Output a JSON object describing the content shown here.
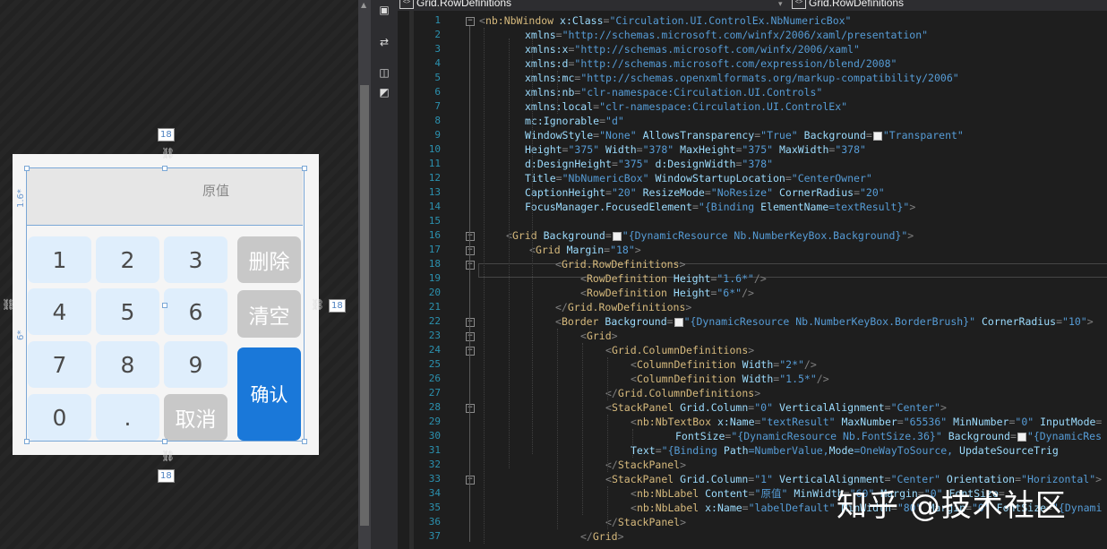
{
  "tabs": [
    {
      "label": "Grid.RowDefinitions"
    },
    {
      "label": "Grid.RowDefinitions"
    }
  ],
  "designer": {
    "result_label": "原值",
    "keypad": {
      "numbers": [
        "1",
        "2",
        "3",
        "4",
        "5",
        "6",
        "7",
        "8",
        "9",
        "0",
        "."
      ],
      "delete": "删除",
      "clear": "清空",
      "cancel": "取消",
      "confirm": "确认"
    },
    "dims": {
      "top": "18",
      "bottom": "18",
      "right": "18",
      "row1": "1.6*",
      "row2": "6*"
    }
  },
  "code": {
    "line_numbers": [
      "1",
      "2",
      "3",
      "4",
      "5",
      "6",
      "7",
      "8",
      "9",
      "10",
      "11",
      "12",
      "13",
      "14",
      "15",
      "16",
      "17",
      "18",
      "19",
      "20",
      "21",
      "22",
      "23",
      "24",
      "25",
      "26",
      "27",
      "28",
      "29",
      "30",
      "31",
      "32",
      "33",
      "34",
      "35",
      "36",
      "37"
    ],
    "lines": [
      [
        [
          "br",
          "<"
        ],
        [
          "el",
          "nb:NbWindow"
        ],
        [
          "tx",
          " "
        ],
        [
          "at",
          "x:Class"
        ],
        [
          "br",
          "="
        ],
        [
          "st",
          "\"Circulation.UI.ControlEx.NbNumericBox\""
        ]
      ],
      [
        [
          "at",
          "xmlns"
        ],
        [
          "br",
          "="
        ],
        [
          "st",
          "\"http://schemas.microsoft.com/winfx/2006/xaml/presentation\""
        ]
      ],
      [
        [
          "at",
          "xmlns:x"
        ],
        [
          "br",
          "="
        ],
        [
          "st",
          "\"http://schemas.microsoft.com/winfx/2006/xaml\""
        ]
      ],
      [
        [
          "at",
          "xmlns:d"
        ],
        [
          "br",
          "="
        ],
        [
          "st",
          "\"http://schemas.microsoft.com/expression/blend/2008\""
        ]
      ],
      [
        [
          "at",
          "xmlns:mc"
        ],
        [
          "br",
          "="
        ],
        [
          "st",
          "\"http://schemas.openxmlformats.org/markup-compatibility/2006\""
        ]
      ],
      [
        [
          "at",
          "xmlns:nb"
        ],
        [
          "br",
          "="
        ],
        [
          "st",
          "\"clr-namespace:Circulation.UI.Controls\""
        ]
      ],
      [
        [
          "at",
          "xmlns:local"
        ],
        [
          "br",
          "="
        ],
        [
          "st",
          "\"clr-namespace:Circulation.UI.ControlEx\""
        ]
      ],
      [
        [
          "at",
          "mc:Ignorable"
        ],
        [
          "br",
          "="
        ],
        [
          "st",
          "\"d\""
        ]
      ],
      [
        [
          "at",
          "WindowStyle"
        ],
        [
          "br",
          "="
        ],
        [
          "st",
          "\"None\""
        ],
        [
          "tx",
          " "
        ],
        [
          "at",
          "AllowsTransparency"
        ],
        [
          "br",
          "="
        ],
        [
          "st",
          "\"True\""
        ],
        [
          "tx",
          " "
        ],
        [
          "at",
          "Background"
        ],
        [
          "br",
          "="
        ],
        [
          "sw",
          ""
        ],
        [
          "st",
          "\"Transparent\""
        ]
      ],
      [
        [
          "at",
          "Height"
        ],
        [
          "br",
          "="
        ],
        [
          "st",
          "\"375\""
        ],
        [
          "tx",
          " "
        ],
        [
          "at",
          "Width"
        ],
        [
          "br",
          "="
        ],
        [
          "st",
          "\"378\""
        ],
        [
          "tx",
          " "
        ],
        [
          "at",
          "MaxHeight"
        ],
        [
          "br",
          "="
        ],
        [
          "st",
          "\"375\""
        ],
        [
          "tx",
          " "
        ],
        [
          "at",
          "MaxWidth"
        ],
        [
          "br",
          "="
        ],
        [
          "st",
          "\"378\""
        ]
      ],
      [
        [
          "at",
          "d:DesignHeight"
        ],
        [
          "br",
          "="
        ],
        [
          "st",
          "\"375\""
        ],
        [
          "tx",
          " "
        ],
        [
          "at",
          "d:DesignWidth"
        ],
        [
          "br",
          "="
        ],
        [
          "st",
          "\"378\""
        ]
      ],
      [
        [
          "at",
          "Title"
        ],
        [
          "br",
          "="
        ],
        [
          "st",
          "\"NbNumericBox\""
        ],
        [
          "tx",
          " "
        ],
        [
          "at",
          "WindowStartupLocation"
        ],
        [
          "br",
          "="
        ],
        [
          "st",
          "\"CenterOwner\""
        ]
      ],
      [
        [
          "at",
          "CaptionHeight"
        ],
        [
          "br",
          "="
        ],
        [
          "st",
          "\"20\""
        ],
        [
          "tx",
          " "
        ],
        [
          "at",
          "ResizeMode"
        ],
        [
          "br",
          "="
        ],
        [
          "st",
          "\"NoResize\""
        ],
        [
          "tx",
          " "
        ],
        [
          "at",
          "CornerRadius"
        ],
        [
          "br",
          "="
        ],
        [
          "st",
          "\"20\""
        ]
      ],
      [
        [
          "at",
          "FocusManager.FocusedElement"
        ],
        [
          "br",
          "="
        ],
        [
          "st",
          "\""
        ],
        [
          "mk",
          "{Binding "
        ],
        [
          "ma",
          "ElementName"
        ],
        [
          "mk",
          "=textResult}"
        ],
        [
          "st",
          "\""
        ],
        [
          "br",
          ">"
        ]
      ],
      [],
      [
        [
          "br",
          "<"
        ],
        [
          "el",
          "Grid"
        ],
        [
          "tx",
          " "
        ],
        [
          "at",
          "Background"
        ],
        [
          "br",
          "="
        ],
        [
          "sw",
          ""
        ],
        [
          "st",
          "\""
        ],
        [
          "mk",
          "{DynamicResource Nb.NumberKeyBox.Background}"
        ],
        [
          "st",
          "\""
        ],
        [
          "br",
          ">"
        ]
      ],
      [
        [
          "br",
          "<"
        ],
        [
          "el",
          "Grid"
        ],
        [
          "tx",
          " "
        ],
        [
          "at",
          "Margin"
        ],
        [
          "br",
          "="
        ],
        [
          "st",
          "\"18\""
        ],
        [
          "br",
          ">"
        ]
      ],
      [
        [
          "br",
          "<"
        ],
        [
          "el",
          "Grid.RowDefinitions"
        ],
        [
          "br",
          ">"
        ]
      ],
      [
        [
          "br",
          "<"
        ],
        [
          "el",
          "RowDefinition"
        ],
        [
          "tx",
          " "
        ],
        [
          "at",
          "Height"
        ],
        [
          "br",
          "="
        ],
        [
          "st",
          "\"1.6*\""
        ],
        [
          "br",
          "/>"
        ]
      ],
      [
        [
          "br",
          "<"
        ],
        [
          "el",
          "RowDefinition"
        ],
        [
          "tx",
          " "
        ],
        [
          "at",
          "Height"
        ],
        [
          "br",
          "="
        ],
        [
          "st",
          "\"6*\""
        ],
        [
          "br",
          "/>"
        ]
      ],
      [
        [
          "br",
          "</"
        ],
        [
          "el",
          "Grid.RowDefinitions"
        ],
        [
          "br",
          ">"
        ]
      ],
      [
        [
          "br",
          "<"
        ],
        [
          "el",
          "Border"
        ],
        [
          "tx",
          " "
        ],
        [
          "at",
          "Background"
        ],
        [
          "br",
          "="
        ],
        [
          "sw",
          ""
        ],
        [
          "st",
          "\""
        ],
        [
          "mk",
          "{DynamicResource Nb.NumberKeyBox.BorderBrush}"
        ],
        [
          "st",
          "\""
        ],
        [
          "tx",
          " "
        ],
        [
          "at",
          "CornerRadius"
        ],
        [
          "br",
          "="
        ],
        [
          "st",
          "\"10\""
        ],
        [
          "br",
          ">"
        ]
      ],
      [
        [
          "br",
          "<"
        ],
        [
          "el",
          "Grid"
        ],
        [
          "br",
          ">"
        ]
      ],
      [
        [
          "br",
          "<"
        ],
        [
          "el",
          "Grid.ColumnDefinitions"
        ],
        [
          "br",
          ">"
        ]
      ],
      [
        [
          "br",
          "<"
        ],
        [
          "el",
          "ColumnDefinition"
        ],
        [
          "tx",
          " "
        ],
        [
          "at",
          "Width"
        ],
        [
          "br",
          "="
        ],
        [
          "st",
          "\"2*\""
        ],
        [
          "br",
          "/>"
        ]
      ],
      [
        [
          "br",
          "<"
        ],
        [
          "el",
          "ColumnDefinition"
        ],
        [
          "tx",
          " "
        ],
        [
          "at",
          "Width"
        ],
        [
          "br",
          "="
        ],
        [
          "st",
          "\"1.5*\""
        ],
        [
          "br",
          "/>"
        ]
      ],
      [
        [
          "br",
          "</"
        ],
        [
          "el",
          "Grid.ColumnDefinitions"
        ],
        [
          "br",
          ">"
        ]
      ],
      [
        [
          "br",
          "<"
        ],
        [
          "el",
          "StackPanel"
        ],
        [
          "tx",
          " "
        ],
        [
          "at",
          "Grid.Column"
        ],
        [
          "br",
          "="
        ],
        [
          "st",
          "\"0\""
        ],
        [
          "tx",
          " "
        ],
        [
          "at",
          "VerticalAlignment"
        ],
        [
          "br",
          "="
        ],
        [
          "st",
          "\"Center\""
        ],
        [
          "br",
          ">"
        ]
      ],
      [
        [
          "br",
          "<"
        ],
        [
          "el",
          "nb:NbTextBox"
        ],
        [
          "tx",
          " "
        ],
        [
          "at",
          "x:Name"
        ],
        [
          "br",
          "="
        ],
        [
          "st",
          "\"textResult\""
        ],
        [
          "tx",
          " "
        ],
        [
          "at",
          "MaxNumber"
        ],
        [
          "br",
          "="
        ],
        [
          "st",
          "\"65536\""
        ],
        [
          "tx",
          " "
        ],
        [
          "at",
          "MinNumber"
        ],
        [
          "br",
          "="
        ],
        [
          "st",
          "\"0\""
        ],
        [
          "tx",
          " "
        ],
        [
          "at",
          "InputMode"
        ],
        [
          "br",
          "="
        ]
      ],
      [
        [
          "at",
          "FontSize"
        ],
        [
          "br",
          "="
        ],
        [
          "st",
          "\""
        ],
        [
          "mk",
          "{DynamicResource Nb.FontSize.36}"
        ],
        [
          "st",
          "\""
        ],
        [
          "tx",
          " "
        ],
        [
          "at",
          "Background"
        ],
        [
          "br",
          "="
        ],
        [
          "sw",
          ""
        ],
        [
          "st",
          "\""
        ],
        [
          "mk",
          "{DynamicRes"
        ]
      ],
      [
        [
          "at",
          "Text"
        ],
        [
          "br",
          "="
        ],
        [
          "st",
          "\""
        ],
        [
          "mk",
          "{Binding "
        ],
        [
          "ma",
          "Path"
        ],
        [
          "mk",
          "=NumberValue,"
        ],
        [
          "ma",
          "Mode"
        ],
        [
          "mk",
          "=OneWayToSource, "
        ],
        [
          "ma",
          "UpdateSourceTrig"
        ]
      ],
      [
        [
          "br",
          "</"
        ],
        [
          "el",
          "StackPanel"
        ],
        [
          "br",
          ">"
        ]
      ],
      [
        [
          "br",
          "<"
        ],
        [
          "el",
          "StackPanel"
        ],
        [
          "tx",
          " "
        ],
        [
          "at",
          "Grid.Column"
        ],
        [
          "br",
          "="
        ],
        [
          "st",
          "\"1\""
        ],
        [
          "tx",
          " "
        ],
        [
          "at",
          "VerticalAlignment"
        ],
        [
          "br",
          "="
        ],
        [
          "st",
          "\"Center\""
        ],
        [
          "tx",
          " "
        ],
        [
          "at",
          "Orientation"
        ],
        [
          "br",
          "="
        ],
        [
          "st",
          "\"Horizontal\""
        ],
        [
          "br",
          ">"
        ]
      ],
      [
        [
          "br",
          "<"
        ],
        [
          "el",
          "nb:NbLabel"
        ],
        [
          "tx",
          " "
        ],
        [
          "at",
          "Content"
        ],
        [
          "br",
          "="
        ],
        [
          "st",
          "\"原值\""
        ],
        [
          "tx",
          " "
        ],
        [
          "at",
          "MinWidth"
        ],
        [
          "br",
          "="
        ],
        [
          "st",
          "\"60\""
        ],
        [
          "tx",
          " "
        ],
        [
          "at",
          "Margin"
        ],
        [
          "br",
          "="
        ],
        [
          "st",
          "\"0\""
        ],
        [
          "tx",
          " "
        ],
        [
          "at",
          "FontSize"
        ],
        [
          "br",
          "="
        ]
      ],
      [
        [
          "br",
          "<"
        ],
        [
          "el",
          "nb:NbLabel"
        ],
        [
          "tx",
          " "
        ],
        [
          "at",
          "x:Name"
        ],
        [
          "br",
          "="
        ],
        [
          "st",
          "\"labelDefault\""
        ],
        [
          "tx",
          " "
        ],
        [
          "at",
          "MinWidth"
        ],
        [
          "br",
          "="
        ],
        [
          "st",
          "\"80\""
        ],
        [
          "tx",
          " "
        ],
        [
          "at",
          "Margin"
        ],
        [
          "br",
          "="
        ],
        [
          "st",
          "\"0\""
        ],
        [
          "tx",
          " "
        ],
        [
          "at",
          "FontSize"
        ],
        [
          "br",
          "="
        ],
        [
          "st",
          "\""
        ],
        [
          "mk",
          "{Dynami"
        ]
      ],
      [
        [
          "br",
          "</"
        ],
        [
          "el",
          "StackPanel"
        ],
        [
          "br",
          ">"
        ]
      ],
      [
        [
          "br",
          "</"
        ],
        [
          "el",
          "Grid"
        ],
        [
          "br",
          ">"
        ]
      ]
    ]
  },
  "watermark": "知乎 @技术社区"
}
